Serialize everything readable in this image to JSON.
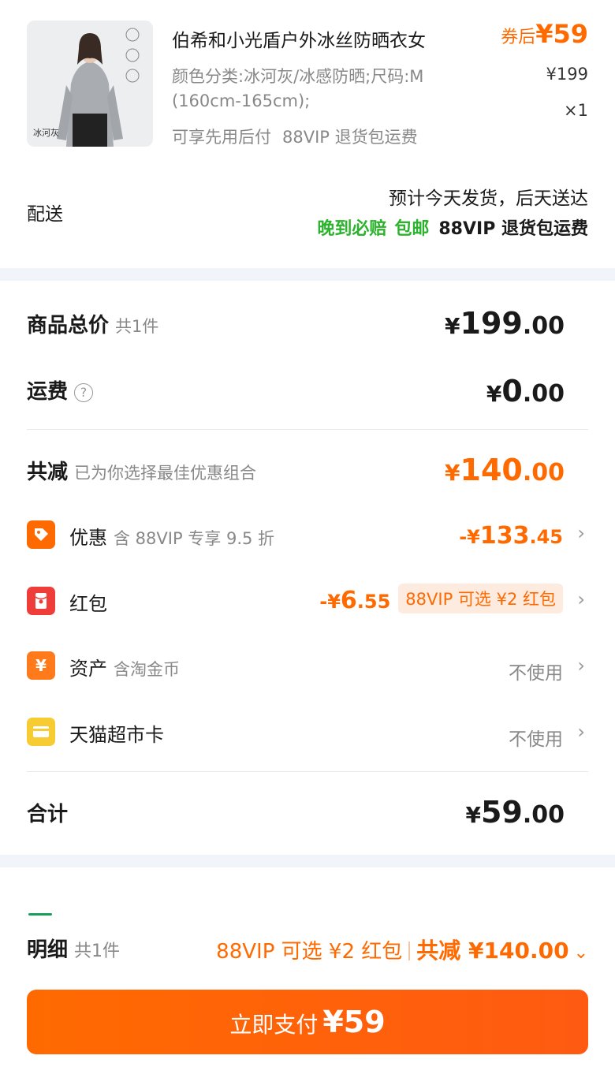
{
  "product": {
    "image_tag": "冰河灰",
    "title": "伯希和小光盾户外冰丝防晒衣女",
    "coupon_label": "券后",
    "coupon_price": "¥59",
    "original_price": "¥199",
    "quantity": "×1",
    "sku": "颜色分类:冰河灰/冰感防晒;尺码:M (160cm-165cm);",
    "services": [
      "可享先用后付",
      "88VIP 退货包运费"
    ]
  },
  "delivery": {
    "label": "配送",
    "eta": "预计今天发货，后天送达",
    "tags": [
      "晚到必赔",
      "包邮"
    ],
    "extra": "88VIP 退货包运费"
  },
  "summary": {
    "goods_total": {
      "label": "商品总价",
      "sub": "共1件",
      "currency": "¥",
      "int": "199",
      "dec": ".00"
    },
    "shipping": {
      "label": "运费",
      "help": "?",
      "currency": "¥",
      "int": "0",
      "dec": ".00"
    },
    "discount_total": {
      "label": "共减",
      "sub": "已为你选择最佳优惠组合",
      "currency": "¥",
      "int": "140",
      "dec": ".00"
    },
    "items": [
      {
        "label": "优惠",
        "sub": "含 88VIP 专享 9.5 折",
        "value_currency": "-¥",
        "value_int": "133",
        "value_dec": ".45",
        "icon": "tag-icon"
      },
      {
        "label": "红包",
        "sub": "",
        "value_currency": "-¥",
        "value_int": "6",
        "value_dec": ".55",
        "chip": "88VIP 可选 ¥2 红包",
        "icon": "red-packet-icon"
      },
      {
        "label": "资产",
        "sub": "含淘金币",
        "value": "不使用",
        "icon": "yen-icon"
      },
      {
        "label": "天猫超市卡",
        "sub": "",
        "value": "不使用",
        "icon": "card-icon"
      }
    ],
    "grand_total": {
      "label": "合计",
      "currency": "¥",
      "int": "59",
      "dec": ".00"
    }
  },
  "bottom": {
    "detail_label": "明细",
    "detail_sub": "共1件",
    "red_packet_hint": "88VIP 可选 ¥2 红包",
    "total_reduce": "共减 ¥140.00",
    "pay_label": "立即支付",
    "pay_amount": "¥59"
  },
  "colors": {
    "accent": "#ff6a00",
    "green": "#2cb22c",
    "background": "#f1f4f8"
  }
}
